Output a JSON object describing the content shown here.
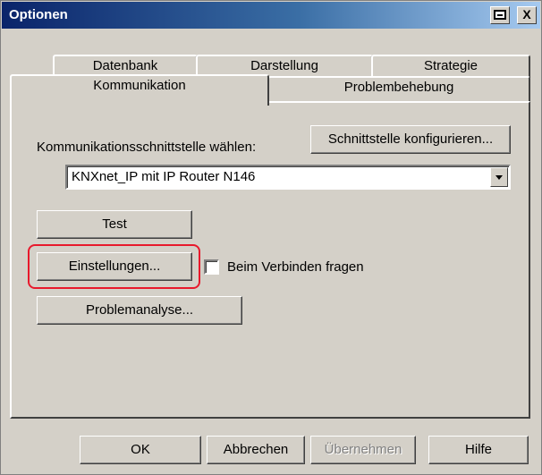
{
  "window": {
    "title": "Optionen",
    "titlebar_buttons": [
      "print-icon",
      "close-icon"
    ],
    "close_label": "X"
  },
  "tabs": {
    "row1": [
      "Datenbank",
      "Darstellung",
      "Strategie"
    ],
    "row2": [
      "Kommunikation",
      "Problembehebung"
    ],
    "active": "Kommunikation"
  },
  "communication": {
    "interface_label": "Kommunikationsschnittstelle wählen:",
    "configure_button": "Schnittstelle konfigurieren...",
    "interface_value": "KNXnet_IP mit IP Router N146",
    "test_button": "Test",
    "settings_button": "Einstellungen...",
    "ask_on_connect_label": "Beim Verbinden fragen",
    "ask_on_connect_checked": false,
    "analysis_button": "Problemanalyse..."
  },
  "footer": {
    "ok": "OK",
    "cancel": "Abbrechen",
    "apply": "Übernehmen",
    "apply_disabled": true,
    "help": "Hilfe"
  },
  "colors": {
    "highlight": "#e8192c",
    "dialog_bg": "#d4d0c8",
    "title_bar": "#0a246a"
  }
}
